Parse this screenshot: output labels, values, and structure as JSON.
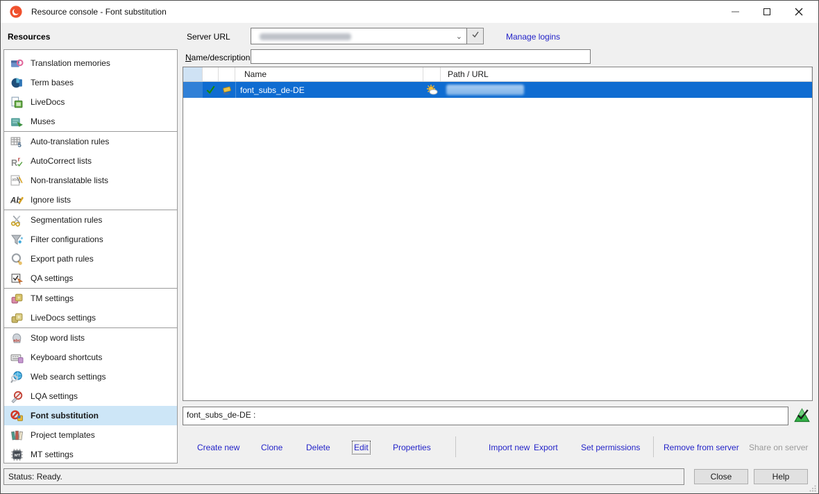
{
  "window": {
    "title": "Resource console - Font substitution"
  },
  "header": {
    "resources_label": "Resources",
    "server_url_label": "Server URL",
    "server_url_redacted": true,
    "manage_logins_label": "Manage logins",
    "name_description_accesskey": "N",
    "name_description_rest": "ame/description",
    "name_description_value": ""
  },
  "sidebar": {
    "items": [
      {
        "label": "Translation memories",
        "icon": "translation-memories-icon"
      },
      {
        "label": "Term bases",
        "icon": "term-bases-icon"
      },
      {
        "label": "LiveDocs",
        "icon": "livedocs-icon"
      },
      {
        "label": "Muses",
        "icon": "muses-icon"
      },
      {
        "label": "Auto-translation rules",
        "icon": "auto-translation-rules-icon"
      },
      {
        "label": "AutoCorrect lists",
        "icon": "autocorrect-lists-icon"
      },
      {
        "label": "Non-translatable lists",
        "icon": "non-translatable-lists-icon"
      },
      {
        "label": "Ignore lists",
        "icon": "ignore-lists-icon"
      },
      {
        "label": "Segmentation rules",
        "icon": "segmentation-rules-icon"
      },
      {
        "label": "Filter configurations",
        "icon": "filter-configurations-icon"
      },
      {
        "label": "Export path rules",
        "icon": "export-path-rules-icon"
      },
      {
        "label": "QA settings",
        "icon": "qa-settings-icon"
      },
      {
        "label": "TM settings",
        "icon": "tm-settings-icon"
      },
      {
        "label": "LiveDocs settings",
        "icon": "livedocs-settings-icon"
      },
      {
        "label": "Stop word lists",
        "icon": "stop-word-lists-icon"
      },
      {
        "label": "Keyboard shortcuts",
        "icon": "keyboard-shortcuts-icon"
      },
      {
        "label": "Web search settings",
        "icon": "web-search-settings-icon"
      },
      {
        "label": "LQA settings",
        "icon": "lqa-settings-icon"
      },
      {
        "label": "Font substitution",
        "icon": "font-substitution-icon",
        "selected": true
      },
      {
        "label": "Project templates",
        "icon": "project-templates-icon"
      },
      {
        "label": "MT settings",
        "icon": "mt-settings-icon"
      }
    ]
  },
  "list": {
    "columns": {
      "name": "Name",
      "path": "Path / URL"
    },
    "rows": [
      {
        "name": "font_subs_de-DE",
        "checked": true,
        "path_redacted": true
      }
    ]
  },
  "details": {
    "text": "font_subs_de-DE :"
  },
  "commands": [
    {
      "label": "Create new",
      "enabled": true
    },
    {
      "label": "Clone",
      "enabled": true
    },
    {
      "label": "Delete",
      "enabled": true
    },
    {
      "label": "Edit",
      "enabled": true,
      "focused": true
    },
    {
      "label": "Properties",
      "enabled": true
    },
    {
      "label": "Import new",
      "enabled": true
    },
    {
      "label": "Export",
      "enabled": true
    },
    {
      "label": "Set permissions",
      "enabled": true
    },
    {
      "label": "Remove from server",
      "enabled": true
    },
    {
      "label": "Share on server",
      "enabled": false
    }
  ],
  "footer": {
    "status": "Status: Ready.",
    "close_label": "Close",
    "help_label": "Help"
  },
  "colors": {
    "selection_blue": "#0f6cd1",
    "sidebar_selection": "#cde6f7",
    "link_blue": "#2323c8",
    "brand_orange": "#f0512e"
  }
}
